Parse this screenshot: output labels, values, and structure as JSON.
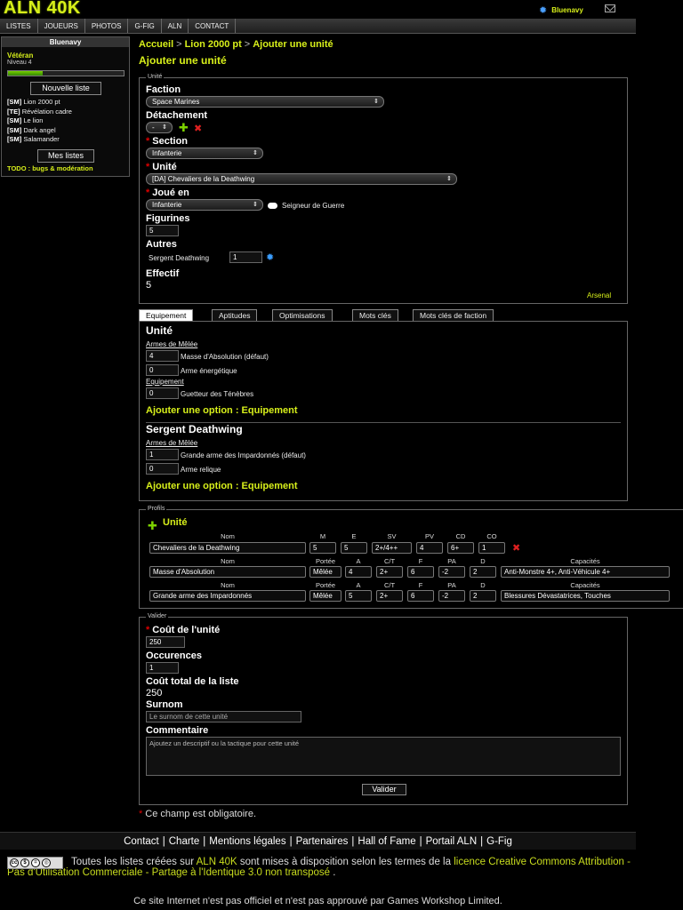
{
  "header": {
    "logo": "ALN 40K",
    "user": "Bluenavy"
  },
  "nav": [
    "LISTES",
    "JOUEURS",
    "PHOTOS",
    "G-FIG",
    "ALN",
    "CONTACT"
  ],
  "sidebar": {
    "user": "Bluenavy",
    "rank": "Vétéran",
    "level": "Niveau 4",
    "level_progress": 0.3,
    "new_list_button": "Nouvelle liste",
    "lists": [
      {
        "tag": "[SM]",
        "name": "Lion 2000 pt"
      },
      {
        "tag": "[TE]",
        "name": "Révélation cadre"
      },
      {
        "tag": "[SM]",
        "name": "Le lion"
      },
      {
        "tag": "[SM]",
        "name": "Dark angel"
      },
      {
        "tag": "[SM]",
        "name": "Salamander"
      }
    ],
    "my_lists_button": "Mes listes",
    "todo": "TODO : bugs & modération"
  },
  "breadcrumb": {
    "home": "Accueil",
    "list": "Lion 2000 pt",
    "current": "Ajouter une unité",
    "separator": ">"
  },
  "page_title": "Ajouter une unité",
  "unit_form": {
    "legend": "Unité",
    "faction_label": "Faction",
    "faction_value": "Space Marines",
    "detachment_label": "Détachement",
    "detachment_value": "-",
    "section_label": "Section",
    "section_value": "Infanterie",
    "unit_label": "Unité",
    "unit_value": "[DA] Chevaliers de la Deathwing",
    "played_label": "Joué en",
    "played_value": "Infanterie",
    "warlord_label": "Seigneur de Guerre",
    "figures_label": "Figurines",
    "figures_value": "5",
    "others_label": "Autres",
    "sergeant_label": "Sergent Deathwing",
    "sergeant_value": "1",
    "strength_label": "Effectif",
    "strength_value": "5",
    "arsenal_link": "Arsenal",
    "required_marker": "*"
  },
  "tabs": [
    "Equipement",
    "Aptitudes",
    "Optimisations",
    "Mots clés",
    "Mots clés de faction"
  ],
  "equipment": {
    "unit_title": "Unité",
    "melee_label": "Armes de Mêlée",
    "equipment_label": "Equipement",
    "unit_items": [
      {
        "qty": "4",
        "name": "Masse d'Absolution (défaut)"
      },
      {
        "qty": "0",
        "name": "Arme énergétique"
      }
    ],
    "unit_equipment_items": [
      {
        "qty": "0",
        "name": "Guetteur des Ténèbres"
      }
    ],
    "add_option": "Ajouter une option : Equipement",
    "sergeant_title": "Sergent Deathwing",
    "sergeant_items": [
      {
        "qty": "1",
        "name": "Grande arme des Impardonnés (défaut)"
      },
      {
        "qty": "0",
        "name": "Arme relique"
      }
    ]
  },
  "profiles": {
    "legend": "Profils",
    "title": "Unité",
    "unit_headers": [
      "Nom",
      "M",
      "E",
      "SV",
      "PV",
      "CD",
      "CO"
    ],
    "unit_row": [
      "Chevaliers de la Deathwing",
      "5",
      "5",
      "2+/4++",
      "4",
      "6+",
      "1"
    ],
    "weapon_headers": [
      "Nom",
      "Portée",
      "A",
      "C/T",
      "F",
      "PA",
      "D",
      "Capacités"
    ],
    "weapon_rows": [
      [
        "Masse d'Absolution",
        "Mêlée",
        "4",
        "2+",
        "6",
        "-2",
        "2",
        "Anti-Monstre 4+, Anti-Véhicule 4+"
      ],
      [
        "Grande arme des Impardonnés",
        "Mêlée",
        "5",
        "2+",
        "6",
        "-2",
        "2",
        "Blessures Dévastatrices, Touches"
      ]
    ]
  },
  "validate_form": {
    "legend": "Valider",
    "cost_label": "Coût de l'unité",
    "cost_value": "250",
    "occurrences_label": "Occurences",
    "occurrences_value": "1",
    "total_label": "Coût total de la liste",
    "total_value": "250",
    "nickname_label": "Surnom",
    "nickname_placeholder": "Le surnom de cette unité",
    "comment_label": "Commentaire",
    "comment_placeholder": "Ajoutez un descriptif ou la tactique pour cette unité",
    "submit": "Valider"
  },
  "required_note": "Ce champ est obligatoire.",
  "footer": {
    "links": [
      "Contact",
      "Charte",
      "Mentions légales",
      "Partenaires",
      "Hall of Fame",
      "Portail ALN",
      "G-Fig"
    ],
    "license_pre": "Toutes les listes créées sur ",
    "license_site": "ALN 40K",
    "license_mid": " sont mises à disposition selon les termes de la ",
    "license_link": "licence Creative Commons Attribution - Pas d'Utilisation Commerciale - Partage à l'Identique 3.0 non transposé",
    "license_end": " .",
    "disclaimer": "Ce site Internet n'est pas officiel et n'est pas approuvé par Games Workshop Limited."
  },
  "colors": {
    "accent": "#d7ef1a",
    "required": "#dd0000",
    "add": "#7dd300"
  }
}
